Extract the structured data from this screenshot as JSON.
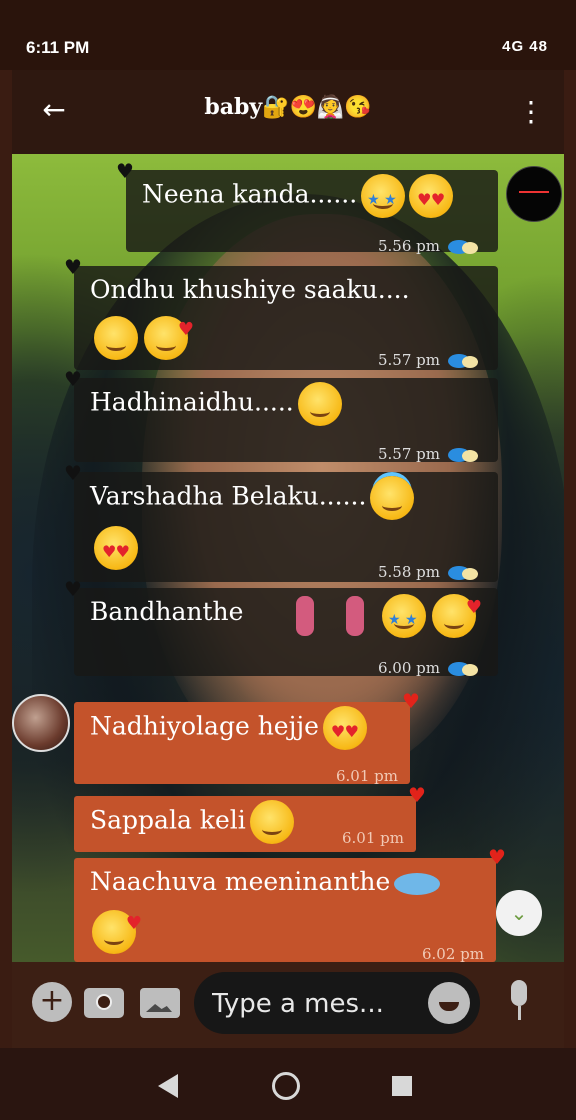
{
  "status_bar": {
    "time": "6:11 PM",
    "right_indicators": "4G 48"
  },
  "header": {
    "title": "baby🔐😍👰😘",
    "icons": {
      "back": "back-arrow-icon",
      "menu": "more-vert-icon"
    }
  },
  "messages": [
    {
      "direction": "sent",
      "text": "Neena kanda......",
      "emojis": [
        "starstruck",
        "heart-eyes"
      ],
      "time": "5.56 pm"
    },
    {
      "direction": "sent",
      "text": "Ondhu khushiye saaku....",
      "emojis": [
        "blush",
        "heart-face"
      ],
      "time": "5.57 pm"
    },
    {
      "direction": "sent",
      "text": "Hadhinaidhu.....",
      "emojis": [
        "smile"
      ],
      "time": "5.57 pm"
    },
    {
      "direction": "sent",
      "text": "Varshadha Belaku......",
      "emojis": [
        "halo",
        "heart-eyes"
      ],
      "time": "5.58 pm"
    },
    {
      "direction": "sent",
      "text": "Bandhanthe",
      "emojis": [
        "dancer",
        "dancer",
        "starstruck",
        "heart-face"
      ],
      "time": "6.00 pm"
    },
    {
      "direction": "received",
      "text": "Nadhiyolage hejje",
      "emojis": [
        "heart-eyes"
      ],
      "time": "6.01 pm"
    },
    {
      "direction": "received",
      "text": "Sappala keli",
      "emojis": [
        "smile"
      ],
      "time": "6.01 pm"
    },
    {
      "direction": "received",
      "text": "Naachuva meeninanthe",
      "emojis": [
        "fish",
        "heart-face"
      ],
      "time": "6.02 pm"
    }
  ],
  "composer": {
    "placeholder": "Type a mes...",
    "icons": [
      "plus-icon",
      "camera-icon",
      "gallery-icon",
      "emoji-icon",
      "mic-icon"
    ]
  },
  "colors": {
    "sent_bubble": "#181816",
    "received_bubble": "#c4532b",
    "read_tick": "#2a8de0",
    "app_bar": "#2e1810"
  }
}
